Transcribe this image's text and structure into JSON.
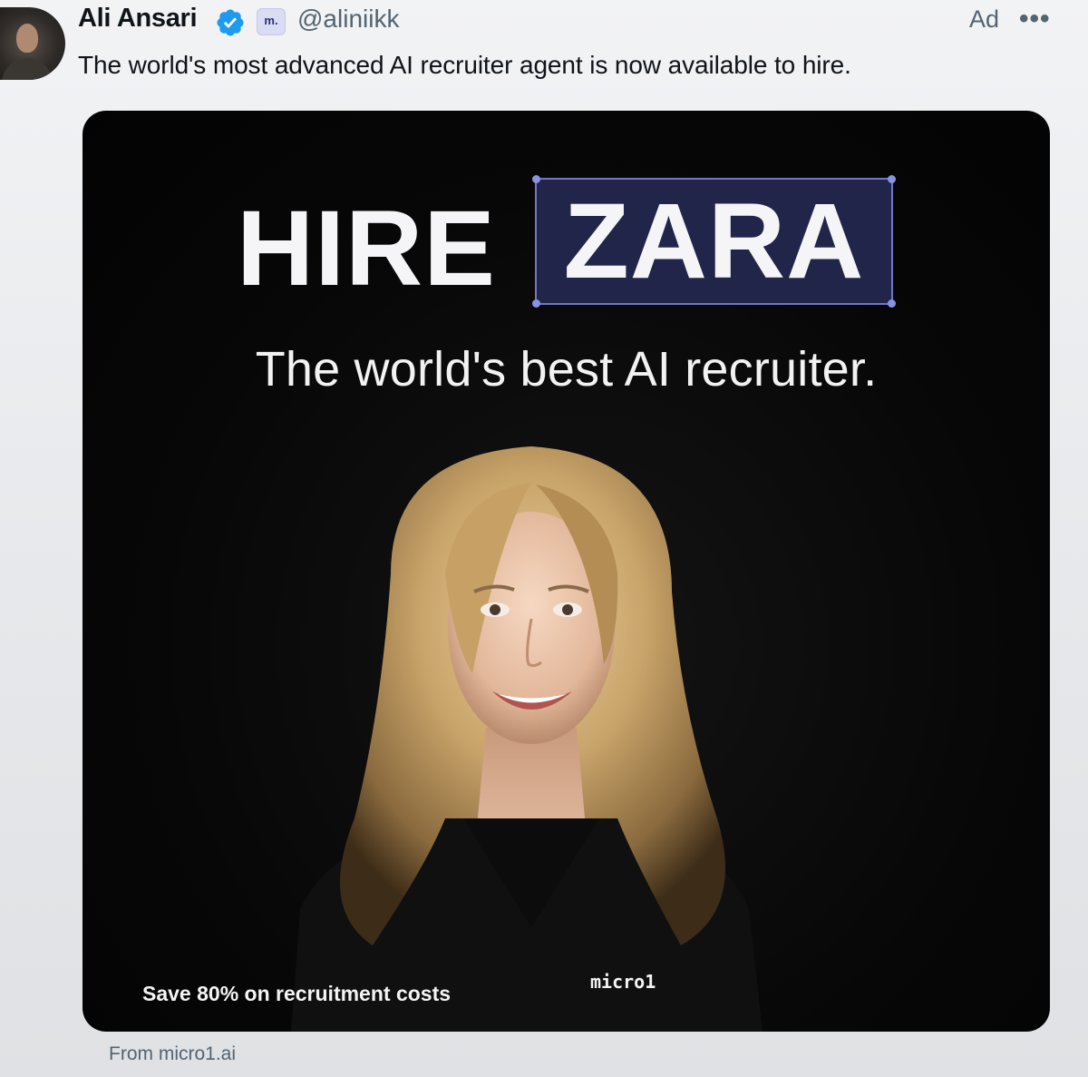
{
  "post": {
    "author_name": "Ali Ansari",
    "verified": true,
    "brand_badge": "m.",
    "handle": "@aliniikk",
    "ad_label": "Ad",
    "more_label": "•••",
    "text": "The world's most advanced AI recruiter agent is now available to hire."
  },
  "ad_creative": {
    "headline_part1": "HIRE",
    "headline_part2": "ZARA",
    "subtitle": "The world's best AI recruiter.",
    "footer_text": "Save 80% on recruitment costs",
    "brand_logo": "micro1"
  },
  "source": "From micro1.ai",
  "colors": {
    "verified_blue": "#1d9bf0",
    "zara_box_bg": "#22254a",
    "selection_handle": "#8b93e0"
  },
  "icons": {
    "verified": "verified-badge-icon",
    "more": "more-options-icon"
  }
}
